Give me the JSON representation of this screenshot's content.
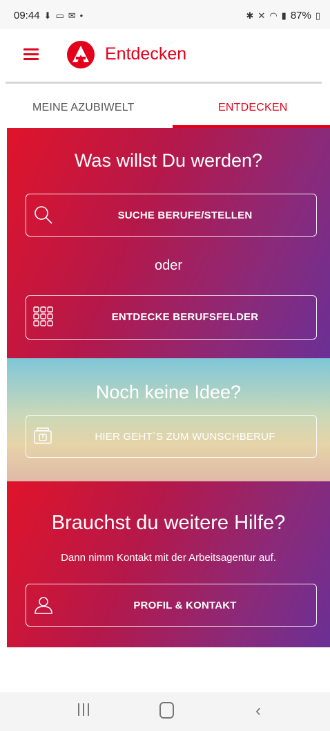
{
  "status_bar": {
    "time": "09:44",
    "left_icons": [
      "download-icon",
      "message-icon",
      "mail-icon",
      "dot-icon"
    ],
    "right_icons": [
      "bluetooth-icon",
      "mute-icon",
      "wifi-icon",
      "signal-icon"
    ],
    "battery": "87%"
  },
  "app_bar": {
    "title": "Entdecken",
    "brand_color": "#e3001b"
  },
  "tabs": [
    {
      "label": "MEINE AZUBIWELT",
      "selected": false
    },
    {
      "label": "ENTDECKEN",
      "selected": true
    }
  ],
  "section_werden": {
    "heading": "Was willst Du werden?",
    "search_button": "SUCHE BERUFE/STELLEN",
    "or_text": "oder",
    "fields_button": "ENTDECKE BERUFSFELDER"
  },
  "section_idee": {
    "heading": "Noch keine Idee?",
    "wish_button": "HIER GEHT`S ZUM WUNSCHBERUF"
  },
  "section_hilfe": {
    "heading": "Brauchst du weitere Hilfe?",
    "subtext": "Dann nimm Kontakt mit der Arbeitsagentur auf.",
    "contact_button": "PROFIL & KONTAKT"
  },
  "nav_bar": {
    "icons": [
      "recents-icon",
      "home-icon",
      "back-icon"
    ]
  }
}
